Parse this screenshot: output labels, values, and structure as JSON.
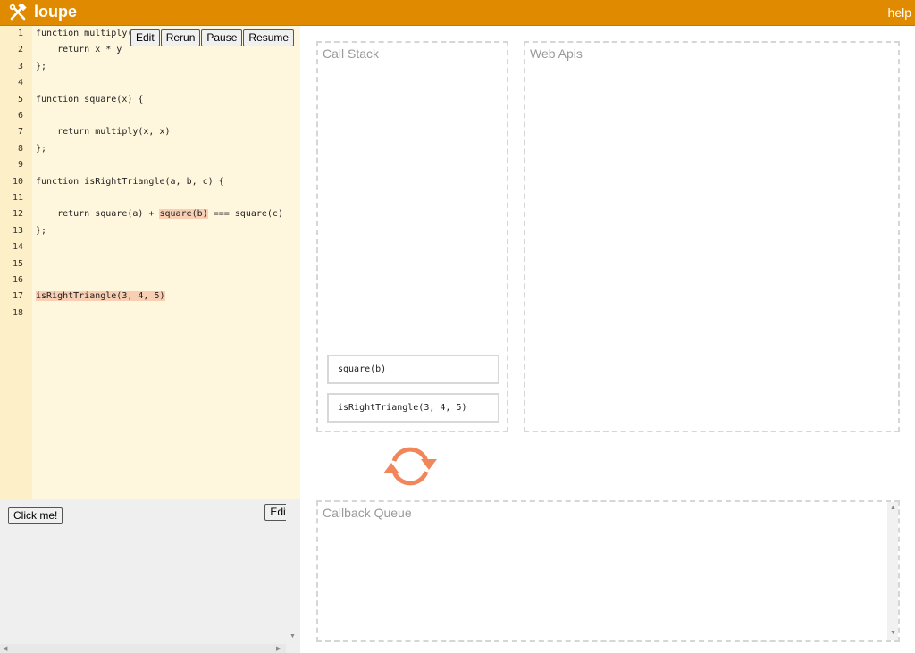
{
  "header": {
    "title": "loupe",
    "help_label": "help",
    "logo_icon": "hammer-wrench-icon",
    "bar_color": "#e08a00"
  },
  "editor": {
    "toolbar": {
      "edit_label": "Edit",
      "rerun_label": "Rerun",
      "pause_label": "Pause",
      "resume_label": "Resume"
    },
    "lines": [
      {
        "num": "1",
        "text": "function multiply(a, b) {"
      },
      {
        "num": "2",
        "text": "    return x * y"
      },
      {
        "num": "3",
        "text": "};"
      },
      {
        "num": "4",
        "text": ""
      },
      {
        "num": "5",
        "text": "function square(x) {"
      },
      {
        "num": "6",
        "text": ""
      },
      {
        "num": "7",
        "text": "    return multiply(x, x)"
      },
      {
        "num": "8",
        "text": "};"
      },
      {
        "num": "9",
        "text": ""
      },
      {
        "num": "10",
        "text": "function isRightTriangle(a, b, c) {"
      },
      {
        "num": "11",
        "text": ""
      },
      {
        "num": "12",
        "pre": "    return square(a) + ",
        "hl": "square(b)",
        "post": " === square(c)"
      },
      {
        "num": "13",
        "text": "};"
      },
      {
        "num": "14",
        "text": ""
      },
      {
        "num": "15",
        "text": ""
      },
      {
        "num": "16",
        "text": ""
      },
      {
        "num": "17",
        "pre": "",
        "hl": "isRightTriangle(3, 4, 5)",
        "post": ""
      },
      {
        "num": "18",
        "text": ""
      }
    ]
  },
  "html_pane": {
    "click_me_label": "Click me!",
    "edit_label": "Edit"
  },
  "call_stack": {
    "title": "Call Stack",
    "frames": [
      "square(b)",
      "isRightTriangle(3, 4, 5)"
    ]
  },
  "web_apis": {
    "title": "Web Apis"
  },
  "callback_queue": {
    "title": "Callback Queue"
  },
  "event_loop": {
    "icon": "refresh-icon",
    "color": "#f0865a"
  }
}
